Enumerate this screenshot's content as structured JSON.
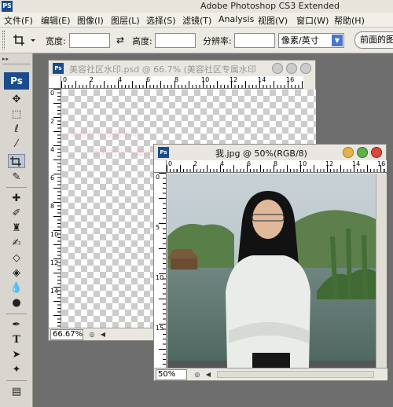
{
  "titlebar": {
    "app_icon": "PS",
    "title": "Adobe Photoshop CS3 Extended"
  },
  "menu": [
    "文件(F)",
    "编辑(E)",
    "图像(I)",
    "图层(L)",
    "选择(S)",
    "滤镜(T)",
    "Analysis",
    "视图(V)",
    "窗口(W)",
    "帮助(H)"
  ],
  "options": {
    "width_label": "宽度:",
    "width_value": "",
    "height_label": "高度:",
    "height_value": "",
    "resolution_label": "分辨率:",
    "resolution_value": "",
    "unit_select": "像素/英寸",
    "front_image_button": "前面的图像"
  },
  "toolbox": {
    "logo": "Ps",
    "tools": [
      "move-tool",
      "marquee-tool",
      "lasso-tool",
      "magic-wand-tool",
      "crop-tool",
      "slice-tool",
      "healing-brush-tool",
      "brush-tool",
      "clone-stamp-tool",
      "history-brush-tool",
      "eraser-tool",
      "paint-bucket-tool",
      "blur-tool",
      "dodge-tool",
      "pen-tool",
      "type-tool",
      "path-selection-tool",
      "custom-shape-tool",
      "notes-tool"
    ]
  },
  "doc1": {
    "icon": "Ps",
    "title": "美容社区水印.psd @ 66.7% (美容社区专属水印",
    "zoom": "66.67%",
    "ruler_h": [
      "0",
      "2",
      "4",
      "6",
      "8",
      "10",
      "12",
      "14",
      "16"
    ],
    "ruler_v": [
      "0",
      "2",
      "4",
      "6",
      "8",
      "10",
      "12",
      "14"
    ],
    "watermark": "美容社区专属水印"
  },
  "doc2": {
    "icon": "Ps",
    "title": "我.jpg @ 50%(RGB/8)",
    "zoom": "50%",
    "ruler_h": [
      "0",
      "2",
      "4",
      "6",
      "8",
      "10",
      "12",
      "14",
      "16"
    ],
    "ruler_v": [
      "0",
      "5",
      "10",
      "15"
    ]
  },
  "colors": {
    "close": "#d9483b",
    "minimize": "#e6b34a",
    "maximize": "#5fb04a",
    "accent": "#1c4c8c"
  }
}
